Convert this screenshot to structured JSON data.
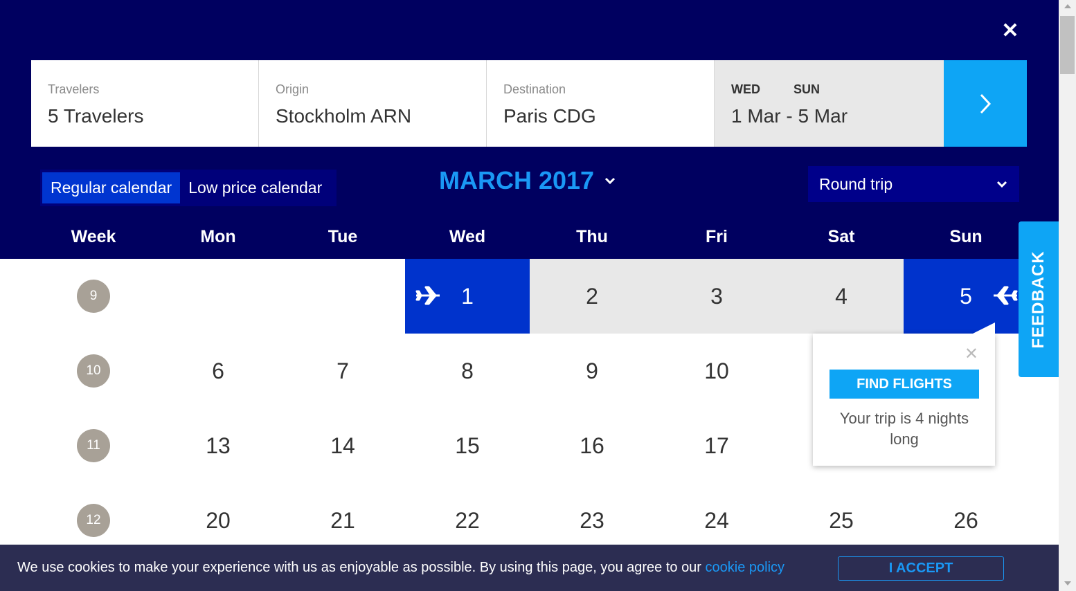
{
  "close_icon": "close-icon",
  "search": {
    "travelers": {
      "label": "Travelers",
      "value": "5 Travelers"
    },
    "origin": {
      "label": "Origin",
      "value": "Stockholm ARN"
    },
    "destination": {
      "label": "Destination",
      "value": "Paris CDG"
    },
    "dates": {
      "day_out": "WED",
      "day_back": "SUN",
      "value": "1 Mar - 5 Mar"
    }
  },
  "calendar_toggle": {
    "regular": "Regular calendar",
    "low_price": "Low price calendar"
  },
  "month_title": "MARCH 2017",
  "trip_type": "Round trip",
  "headers": {
    "week": "Week",
    "mon": "Mon",
    "tue": "Tue",
    "wed": "Wed",
    "thu": "Thu",
    "fri": "Fri",
    "sat": "Sat",
    "sun": "Sun"
  },
  "weeks": [
    {
      "num": "9",
      "days": [
        "",
        "",
        "1",
        "2",
        "3",
        "4",
        "5"
      ]
    },
    {
      "num": "10",
      "days": [
        "6",
        "7",
        "8",
        "9",
        "10",
        "",
        ""
      ]
    },
    {
      "num": "11",
      "days": [
        "13",
        "14",
        "15",
        "16",
        "17",
        "",
        ""
      ]
    },
    {
      "num": "12",
      "days": [
        "20",
        "21",
        "22",
        "23",
        "24",
        "25",
        "26"
      ]
    }
  ],
  "feedback": "FEEDBACK",
  "popover": {
    "button": "FIND FLIGHTS",
    "message": "Your trip is 4 nights long"
  },
  "cookie": {
    "text": "We use cookies to make your experience with us as enjoyable as possible. By using this page, you agree to our ",
    "link": "cookie policy",
    "accept": "I ACCEPT"
  },
  "colors": {
    "navy": "#000060",
    "accent": "#0ea5f5",
    "selected": "#0033cc",
    "range": "#e8e8e8"
  }
}
